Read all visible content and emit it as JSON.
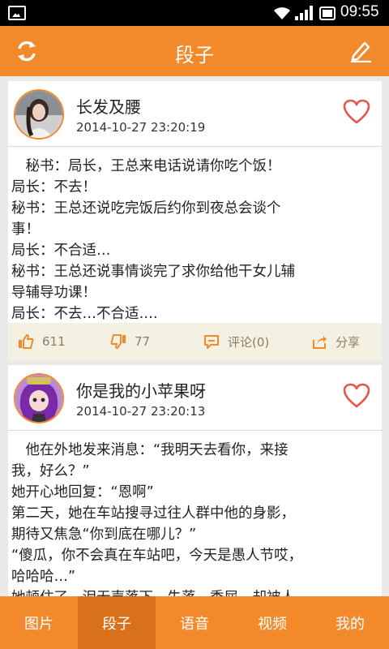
{
  "status": {
    "time": "09:55"
  },
  "header": {
    "title": "段子"
  },
  "posts": [
    {
      "user": "长发及腰",
      "date": "2014-10-27 23:20:19",
      "lines": [
        "　秘书：局长，王总来电话说请你吃个饭！",
        "局长：不去！",
        "秘书：王总还说吃完饭后约你到夜总会谈个",
        "事！",
        "局长：不合适…",
        "秘书：王总还说事情谈完了求你给他干女儿辅",
        "导辅导功课！",
        "局长：不去…不合适…."
      ],
      "likes": "611",
      "dislikes": "77",
      "comment": "评论(0)",
      "share": "分享"
    },
    {
      "user": "你是我的小苹果呀",
      "date": "2014-10-27 23:20:13",
      "lines": [
        "　他在外地发来消息：“我明天去看你，来接",
        "我，好么？”",
        "她开心地回复：“恩啊”",
        "第二天，她在车站搜寻过往人群中他的身影，",
        "期待又焦急“你到底在哪儿？”",
        "“傻瓜，你不会真在车站吧，今天是愚人节哎，",
        "哈哈哈…”",
        "她顿住了，泪无声落下，失落、委屈…却被人"
      ]
    }
  ],
  "tabs": [
    "图片",
    "段子",
    "语音",
    "视频",
    "我的"
  ],
  "colors": {
    "accent": "#f28a2c",
    "active_tab": "#d9701c"
  }
}
